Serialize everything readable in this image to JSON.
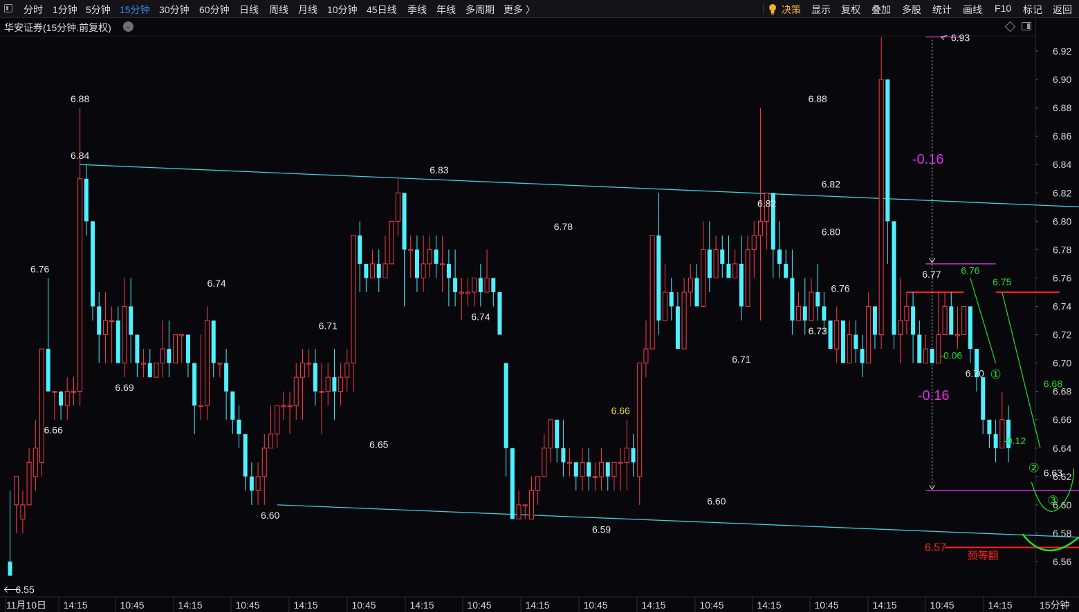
{
  "toolbar": {
    "left_items": [
      {
        "label": "分时",
        "x": 34
      },
      {
        "label": "1分钟",
        "x": 76
      },
      {
        "label": "5分钟",
        "x": 124
      },
      {
        "label": "15分钟",
        "x": 173,
        "active": true
      },
      {
        "label": "30分钟",
        "x": 230
      },
      {
        "label": "60分钟",
        "x": 288
      },
      {
        "label": "日线",
        "x": 346
      },
      {
        "label": "周线",
        "x": 389
      },
      {
        "label": "月线",
        "x": 431
      },
      {
        "label": "10分钟",
        "x": 473
      },
      {
        "label": "45日线",
        "x": 530
      },
      {
        "label": "季线",
        "x": 589
      },
      {
        "label": "年线",
        "x": 631
      },
      {
        "label": "多周期",
        "x": 673
      },
      {
        "label": "更多 〉",
        "x": 728
      }
    ],
    "right_items": [
      {
        "label": "决策",
        "x": 1130,
        "gold": true
      },
      {
        "label": "显示",
        "x": 1173
      },
      {
        "label": "复权",
        "x": 1216
      },
      {
        "label": "叠加",
        "x": 1260
      },
      {
        "label": "多股",
        "x": 1304
      },
      {
        "label": "统计",
        "x": 1348
      },
      {
        "label": "画线",
        "x": 1392
      },
      {
        "label": "F10",
        "x": 1438
      },
      {
        "label": "标记",
        "x": 1479
      },
      {
        "label": "返回",
        "x": 1522
      }
    ],
    "decision_icon": "lightbulb-icon"
  },
  "stock_title": "华安证券(15分钟.前复权)",
  "period_label": "15分钟",
  "colors": {
    "up": "#ff3b4a",
    "down": "#4ff0ff",
    "channel": "#3ad0e0",
    "magenta": "#e030e0",
    "red_line": "#ff2020",
    "green": "#22e022",
    "label": "#e8e8e8",
    "grid_axis": "#2a2a30"
  },
  "chart_data": {
    "type": "candlestick",
    "title": "华安证券(15分钟.前复权)",
    "ylim": [
      6.54,
      6.935
    ],
    "y_ticks": [
      6.56,
      6.58,
      6.6,
      6.62,
      6.64,
      6.66,
      6.68,
      6.7,
      6.72,
      6.74,
      6.76,
      6.78,
      6.8,
      6.82,
      6.84,
      6.86,
      6.88,
      6.9,
      6.92
    ],
    "x_labels": [
      "11月10日",
      "14:15",
      "10:45",
      "14:15",
      "10:45",
      "14:15",
      "10:45",
      "14:15",
      "10:45",
      "14:15",
      "10:45",
      "14:15",
      "10:45",
      "14:15",
      "10:45",
      "14:15",
      "10:45",
      "14:15"
    ],
    "candles": [
      [
        6.56,
        6.55,
        6.61,
        6.55
      ],
      [
        6.6,
        6.62,
        6.62,
        6.58
      ],
      [
        6.59,
        6.6,
        6.61,
        6.58
      ],
      [
        6.6,
        6.63,
        6.64,
        6.6
      ],
      [
        6.62,
        6.64,
        6.66,
        6.61
      ],
      [
        6.63,
        6.71,
        6.71,
        6.62
      ],
      [
        6.71,
        6.68,
        6.76,
        6.68
      ],
      [
        6.68,
        6.68,
        6.68,
        6.66
      ],
      [
        6.68,
        6.67,
        6.68,
        6.66
      ],
      [
        6.67,
        6.68,
        6.69,
        6.66
      ],
      [
        6.68,
        6.68,
        6.69,
        6.67
      ],
      [
        6.68,
        6.83,
        6.88,
        6.67
      ],
      [
        6.83,
        6.8,
        6.84,
        6.79
      ],
      [
        6.8,
        6.74,
        6.8,
        6.73
      ],
      [
        6.74,
        6.72,
        6.75,
        6.7
      ],
      [
        6.72,
        6.73,
        6.75,
        6.7
      ],
      [
        6.73,
        6.73,
        6.74,
        6.7
      ],
      [
        6.73,
        6.7,
        6.74,
        6.7
      ],
      [
        6.7,
        6.74,
        6.76,
        6.69
      ],
      [
        6.74,
        6.72,
        6.76,
        6.7
      ],
      [
        6.72,
        6.7,
        6.72,
        6.69
      ],
      [
        6.7,
        6.7,
        6.71,
        6.69
      ],
      [
        6.7,
        6.69,
        6.71,
        6.69
      ],
      [
        6.69,
        6.7,
        6.7,
        6.69
      ],
      [
        6.7,
        6.71,
        6.73,
        6.69
      ],
      [
        6.71,
        6.7,
        6.73,
        6.69
      ],
      [
        6.7,
        6.72,
        6.72,
        6.7
      ],
      [
        6.72,
        6.72,
        6.72,
        6.7
      ],
      [
        6.72,
        6.7,
        6.72,
        6.69
      ],
      [
        6.7,
        6.67,
        6.7,
        6.65
      ],
      [
        6.67,
        6.67,
        6.72,
        6.66
      ],
      [
        6.67,
        6.73,
        6.74,
        6.66
      ],
      [
        6.73,
        6.7,
        6.73,
        6.69
      ],
      [
        6.7,
        6.7,
        6.7,
        6.69
      ],
      [
        6.7,
        6.68,
        6.71,
        6.66
      ],
      [
        6.68,
        6.66,
        6.68,
        6.65
      ],
      [
        6.66,
        6.65,
        6.67,
        6.64
      ],
      [
        6.65,
        6.62,
        6.65,
        6.61
      ],
      [
        6.62,
        6.61,
        6.63,
        6.6
      ],
      [
        6.61,
        6.62,
        6.63,
        6.6
      ],
      [
        6.62,
        6.64,
        6.65,
        6.6
      ],
      [
        6.64,
        6.65,
        6.67,
        6.64
      ],
      [
        6.65,
        6.67,
        6.67,
        6.64
      ],
      [
        6.67,
        6.67,
        6.68,
        6.66
      ],
      [
        6.67,
        6.67,
        6.68,
        6.65
      ],
      [
        6.67,
        6.69,
        6.7,
        6.66
      ],
      [
        6.69,
        6.7,
        6.71,
        6.66
      ],
      [
        6.7,
        6.7,
        6.71,
        6.69
      ],
      [
        6.7,
        6.68,
        6.71,
        6.67
      ],
      [
        6.68,
        6.68,
        6.7,
        6.65
      ],
      [
        6.68,
        6.69,
        6.7,
        6.67
      ],
      [
        6.69,
        6.68,
        6.71,
        6.66
      ],
      [
        6.68,
        6.69,
        6.7,
        6.67
      ],
      [
        6.69,
        6.7,
        6.71,
        6.68
      ],
      [
        6.7,
        6.79,
        6.79,
        6.68
      ],
      [
        6.79,
        6.77,
        6.8,
        6.75
      ],
      [
        6.77,
        6.76,
        6.77,
        6.75
      ],
      [
        6.76,
        6.77,
        6.78,
        6.76
      ],
      [
        6.77,
        6.76,
        6.78,
        6.75
      ],
      [
        6.76,
        6.77,
        6.79,
        6.76
      ],
      [
        6.77,
        6.8,
        6.8,
        6.77
      ],
      [
        6.8,
        6.82,
        6.83,
        6.79
      ],
      [
        6.82,
        6.78,
        6.82,
        6.74
      ],
      [
        6.78,
        6.78,
        6.79,
        6.76
      ],
      [
        6.78,
        6.76,
        6.79,
        6.75
      ],
      [
        6.76,
        6.77,
        6.79,
        6.75
      ],
      [
        6.77,
        6.78,
        6.79,
        6.76
      ],
      [
        6.78,
        6.77,
        6.79,
        6.76
      ],
      [
        6.77,
        6.77,
        6.79,
        6.75
      ],
      [
        6.77,
        6.76,
        6.78,
        6.74
      ],
      [
        6.76,
        6.75,
        6.78,
        6.74
      ],
      [
        6.75,
        6.75,
        6.76,
        6.73
      ],
      [
        6.75,
        6.75,
        6.76,
        6.74
      ],
      [
        6.75,
        6.76,
        6.76,
        6.74
      ],
      [
        6.76,
        6.75,
        6.77,
        6.74
      ],
      [
        6.75,
        6.76,
        6.78,
        6.75
      ],
      [
        6.76,
        6.75,
        6.76,
        6.74
      ],
      [
        6.75,
        6.72,
        6.75,
        6.72
      ],
      [
        6.7,
        6.64,
        6.7,
        6.62
      ],
      [
        6.64,
        6.59,
        6.64,
        6.59
      ],
      [
        6.59,
        6.6,
        6.61,
        6.6
      ],
      [
        6.6,
        6.6,
        6.6,
        6.59
      ],
      [
        6.59,
        6.61,
        6.62,
        6.59
      ],
      [
        6.61,
        6.62,
        6.62,
        6.6
      ],
      [
        6.62,
        6.64,
        6.65,
        6.62
      ],
      [
        6.64,
        6.66,
        6.66,
        6.63
      ],
      [
        6.66,
        6.64,
        6.66,
        6.63
      ],
      [
        6.64,
        6.63,
        6.66,
        6.62
      ],
      [
        6.63,
        6.63,
        6.64,
        6.62
      ],
      [
        6.63,
        6.62,
        6.63,
        6.61
      ],
      [
        6.62,
        6.63,
        6.64,
        6.61
      ],
      [
        6.63,
        6.62,
        6.64,
        6.61
      ],
      [
        6.62,
        6.62,
        6.63,
        6.61
      ],
      [
        6.62,
        6.63,
        6.64,
        6.61
      ],
      [
        6.63,
        6.62,
        6.63,
        6.61
      ],
      [
        6.62,
        6.63,
        6.63,
        6.61
      ],
      [
        6.63,
        6.63,
        6.64,
        6.61
      ],
      [
        6.63,
        6.64,
        6.66,
        6.61
      ],
      [
        6.64,
        6.63,
        6.65,
        6.62
      ],
      [
        6.62,
        6.7,
        6.7,
        6.6
      ],
      [
        6.7,
        6.71,
        6.73,
        6.69
      ],
      [
        6.71,
        6.79,
        6.79,
        6.71
      ],
      [
        6.79,
        6.73,
        6.82,
        6.72
      ],
      [
        6.73,
        6.75,
        6.77,
        6.73
      ],
      [
        6.75,
        6.74,
        6.76,
        6.73
      ],
      [
        6.74,
        6.71,
        6.75,
        6.71
      ],
      [
        6.71,
        6.75,
        6.76,
        6.71
      ],
      [
        6.75,
        6.76,
        6.77,
        6.74
      ],
      [
        6.76,
        6.74,
        6.77,
        6.74
      ],
      [
        6.74,
        6.78,
        6.8,
        6.74
      ],
      [
        6.78,
        6.76,
        6.8,
        6.75
      ],
      [
        6.76,
        6.78,
        6.79,
        6.76
      ],
      [
        6.78,
        6.77,
        6.79,
        6.76
      ],
      [
        6.77,
        6.76,
        6.79,
        6.76
      ],
      [
        6.76,
        6.77,
        6.78,
        6.76
      ],
      [
        6.77,
        6.74,
        6.79,
        6.73
      ],
      [
        6.74,
        6.78,
        6.79,
        6.74
      ],
      [
        6.78,
        6.79,
        6.8,
        6.76
      ],
      [
        6.79,
        6.8,
        6.88,
        6.73
      ],
      [
        6.8,
        6.82,
        6.82,
        6.78
      ],
      [
        6.82,
        6.78,
        6.82,
        6.76
      ],
      [
        6.78,
        6.77,
        6.8,
        6.76
      ],
      [
        6.77,
        6.76,
        6.78,
        6.76
      ],
      [
        6.76,
        6.73,
        6.78,
        6.72
      ],
      [
        6.73,
        6.74,
        6.75,
        6.73
      ],
      [
        6.74,
        6.73,
        6.76,
        6.72
      ],
      [
        6.73,
        6.75,
        6.76,
        6.73
      ],
      [
        6.75,
        6.74,
        6.77,
        6.73
      ],
      [
        6.74,
        6.73,
        6.75,
        6.72
      ],
      [
        6.73,
        6.71,
        6.73,
        6.71
      ],
      [
        6.71,
        6.73,
        6.74,
        6.7
      ],
      [
        6.73,
        6.7,
        6.73,
        6.7
      ],
      [
        6.7,
        6.72,
        6.73,
        6.7
      ],
      [
        6.72,
        6.71,
        6.73,
        6.7
      ],
      [
        6.71,
        6.7,
        6.72,
        6.69
      ],
      [
        6.7,
        6.74,
        6.75,
        6.7
      ],
      [
        6.74,
        6.72,
        6.74,
        6.71
      ],
      [
        6.72,
        6.9,
        6.93,
        6.71
      ],
      [
        6.9,
        6.8,
        6.9,
        6.77
      ],
      [
        6.8,
        6.72,
        6.8,
        6.71
      ],
      [
        6.72,
        6.73,
        6.76,
        6.7
      ],
      [
        6.73,
        6.74,
        6.75,
        6.72
      ],
      [
        6.74,
        6.72,
        6.75,
        6.7
      ],
      [
        6.72,
        6.7,
        6.73,
        6.7
      ],
      [
        6.7,
        6.71,
        6.72,
        6.7
      ],
      [
        6.71,
        6.7,
        6.71,
        6.7
      ],
      [
        6.7,
        6.72,
        6.75,
        6.7
      ],
      [
        6.72,
        6.74,
        6.75,
        6.72
      ],
      [
        6.74,
        6.72,
        6.75,
        6.72
      ],
      [
        6.72,
        6.72,
        6.74,
        6.71
      ],
      [
        6.72,
        6.74,
        6.74,
        6.72
      ],
      [
        6.74,
        6.71,
        6.74,
        6.7
      ],
      [
        6.71,
        6.69,
        6.71,
        6.68
      ],
      [
        6.69,
        6.66,
        6.69,
        6.65
      ],
      [
        6.66,
        6.65,
        6.66,
        6.64
      ],
      [
        6.65,
        6.64,
        6.66,
        6.63
      ],
      [
        6.64,
        6.66,
        6.68,
        6.64
      ],
      [
        6.66,
        6.64,
        6.67,
        6.63
      ]
    ],
    "price_labels": [
      {
        "text": "6.88",
        "index": 11,
        "price": 6.88,
        "pos": "above"
      },
      {
        "text": "6.84",
        "index": 11,
        "price": 6.84,
        "pos": "above"
      },
      {
        "text": "6.76",
        "index": 6,
        "price": 6.76,
        "pos": "above",
        "dx": -12
      },
      {
        "text": "6.66",
        "index": 9,
        "price": 6.66,
        "pos": "below",
        "dx": -20
      },
      {
        "text": "6.69",
        "index": 18,
        "price": 6.69,
        "pos": "below",
        "dx": 0
      },
      {
        "text": "6.74",
        "index": 34,
        "price": 6.75,
        "pos": "above",
        "dx": -14
      },
      {
        "text": "6.71",
        "index": 50,
        "price": 6.72,
        "pos": "above",
        "dx": 0
      },
      {
        "text": "6.65",
        "index": 58,
        "price": 6.65,
        "pos": "below",
        "dx": 0
      },
      {
        "text": "6.60",
        "index": 42,
        "price": 6.6,
        "pos": "below",
        "dx": -10
      },
      {
        "text": "6.83",
        "index": 69,
        "price": 6.83,
        "pos": "above",
        "dx": -14
      },
      {
        "text": "6.74",
        "index": 74,
        "price": 6.74,
        "pos": "below",
        "dx": 0
      },
      {
        "text": "6.78",
        "index": 87,
        "price": 6.79,
        "pos": "above",
        "dx": 0
      },
      {
        "text": "6.66",
        "index": 96,
        "price": 6.66,
        "pos": "above",
        "dx": 0,
        "yellow": true
      },
      {
        "text": "6.59",
        "index": 93,
        "price": 6.59,
        "pos": "below",
        "dx": 0
      },
      {
        "text": "6.60",
        "index": 110,
        "price": 6.61,
        "pos": "below",
        "dx": 10
      },
      {
        "text": "6.71",
        "index": 115,
        "price": 6.71,
        "pos": "below",
        "dx": 0
      },
      {
        "text": "6.82",
        "index": 119,
        "price": 6.82,
        "pos": "below",
        "dx": 0
      },
      {
        "text": "6.88",
        "index": 127,
        "price": 6.88,
        "pos": "above",
        "dx": 0
      },
      {
        "text": "6.73",
        "index": 127,
        "price": 6.73,
        "pos": "below",
        "dx": 0
      },
      {
        "text": "6.82",
        "index": 128,
        "price": 6.82,
        "pos": "above",
        "dx": 10
      },
      {
        "text": "6.80",
        "index": 128,
        "price": 6.8,
        "pos": "below",
        "dx": 10
      },
      {
        "text": "6.76",
        "index": 131,
        "price": 6.76,
        "pos": "below",
        "dx": -4
      },
      {
        "text": "6.93",
        "index": 146,
        "price": 6.93,
        "pos": "right",
        "dx": 4
      },
      {
        "text": "6.77",
        "index": 146,
        "price": 6.77,
        "pos": "below",
        "dx": -10
      },
      {
        "text": "6.70",
        "index": 153,
        "price": 6.7,
        "pos": "below",
        "dx": -12
      },
      {
        "text": "6.63",
        "index": 164,
        "price": 6.63,
        "pos": "below",
        "dx": 0
      }
    ],
    "annotations": {
      "channel_upper": {
        "from": [
          11,
          6.84
        ],
        "to": [
          169,
          6.81
        ]
      },
      "channel_lower": {
        "from": [
          42,
          6.6
        ],
        "to": [
          169,
          6.577
        ]
      },
      "magenta_top": {
        "from": [
          144,
          6.93
        ],
        "to": [
          150,
          6.93
        ]
      },
      "magenta_mid": {
        "from": [
          144,
          6.77
        ],
        "to": [
          155,
          6.77
        ]
      },
      "magenta_bottom": {
        "from": [
          144,
          6.61
        ],
        "to": [
          169,
          6.61
        ]
      },
      "drop_arrow": {
        "index": 145,
        "top": 6.93,
        "mid": 6.77,
        "bottom": 6.61
      },
      "drop_text_top": "-0.16",
      "drop_text_bottom": "-0.16",
      "red_line_1": {
        "from": [
          141,
          6.75
        ],
        "to": [
          150,
          6.75
        ]
      },
      "red_line_2": {
        "from": [
          155,
          6.75
        ],
        "to": [
          165,
          6.75
        ]
      },
      "neckline": {
        "from": [
          147,
          6.57
        ],
        "to": [
          169,
          6.57
        ]
      },
      "neck_price": "6.57",
      "neck_text": "颈等翻",
      "green_labels": [
        {
          "text": "6.76",
          "index": 151,
          "price": 6.76
        },
        {
          "text": "6.75",
          "index": 156,
          "price": 6.752
        },
        {
          "text": "-0.06",
          "index": 148,
          "price": 6.7
        },
        {
          "text": "-0.12",
          "index": 158,
          "price": 6.64
        },
        {
          "text": "6.68",
          "index": 164,
          "price": 6.68
        }
      ],
      "circled": [
        {
          "text": "①",
          "index": 155,
          "price": 6.693
        },
        {
          "text": "②",
          "index": 161,
          "price": 6.627
        },
        {
          "text": "③",
          "index": 164,
          "price": 6.604
        }
      ],
      "green_path_1": [
        [
          151,
          6.76
        ],
        [
          155,
          6.7
        ]
      ],
      "green_path_2": [
        [
          156,
          6.75
        ],
        [
          162,
          6.64
        ]
      ],
      "green_arc_small": {
        "index": 164,
        "price": 6.613
      },
      "green_arc_big": {
        "index": 164,
        "price": 6.577
      }
    }
  }
}
